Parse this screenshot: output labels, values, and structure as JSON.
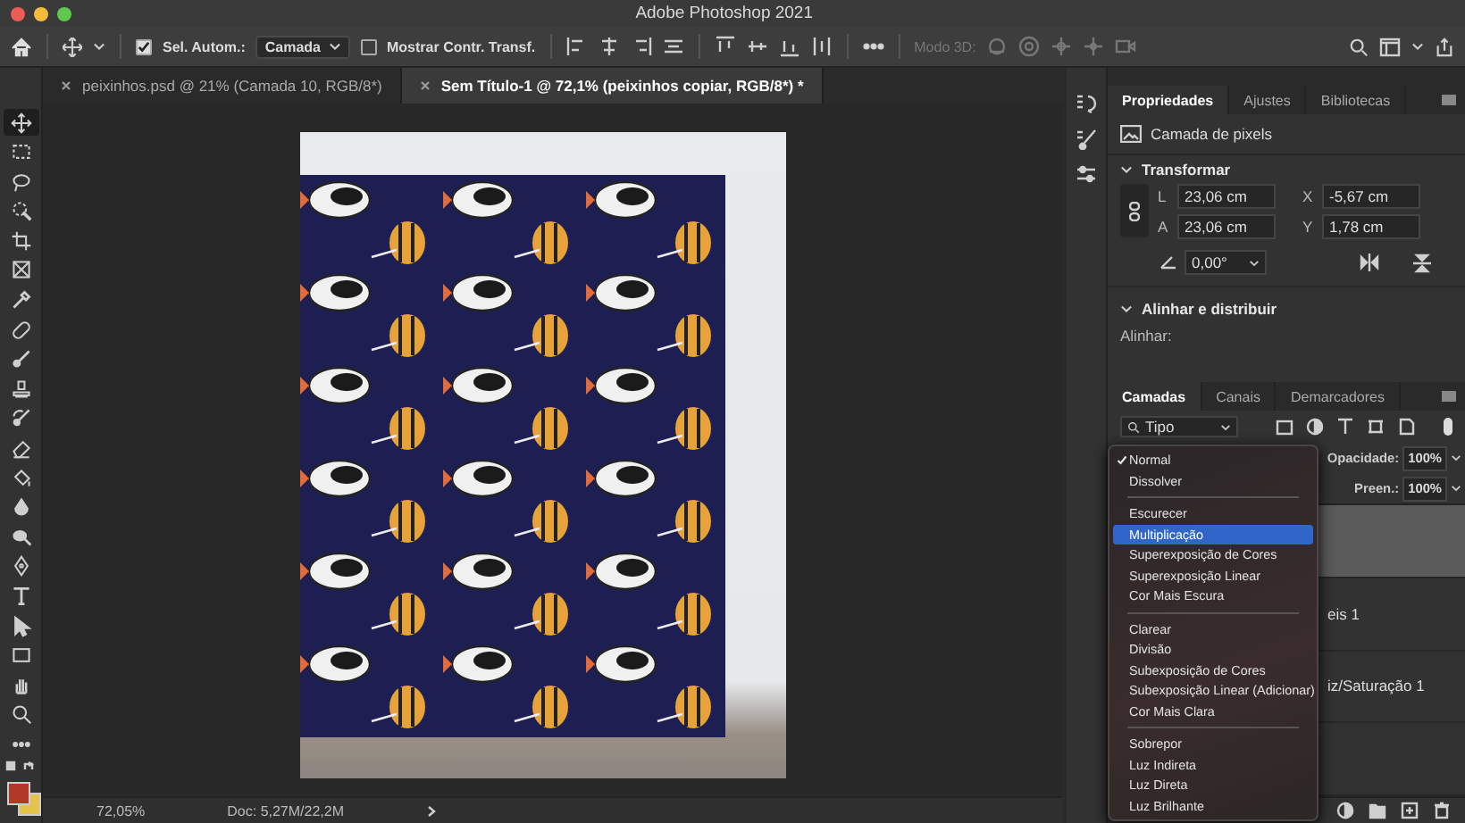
{
  "window": {
    "title": "Adobe Photoshop 2021"
  },
  "options_bar": {
    "auto_select": {
      "label": "Sel. Autom.:",
      "checked": true
    },
    "auto_select_target": "Camada",
    "transform_controls": {
      "label": "Mostrar Contr. Transf.",
      "checked": false
    },
    "mode_3d_label": "Modo 3D:"
  },
  "document_tabs": [
    {
      "label": "peixinhos.psd @ 21% (Camada 10, RGB/8*)",
      "selected": false
    },
    {
      "label": "Sem Título-1 @ 72,1% (peixinhos copiar, RGB/8*) *",
      "selected": true
    }
  ],
  "toolbar": {
    "tools": [
      {
        "selected": true
      },
      {
        "selected": false
      },
      {
        "selected": false
      },
      {
        "selected": false
      },
      {
        "selected": false
      },
      {
        "selected": false
      },
      {
        "selected": false
      },
      {
        "selected": false
      },
      {
        "selected": false
      },
      {
        "selected": false
      },
      {
        "selected": false
      },
      {
        "selected": false
      },
      {
        "selected": false
      },
      {
        "selected": false
      },
      {
        "selected": false
      },
      {
        "selected": false
      },
      {
        "selected": false
      },
      {
        "selected": false
      },
      {
        "selected": false
      },
      {
        "selected": false
      },
      {
        "selected": false
      },
      {
        "selected": false
      }
    ],
    "swatches": [
      {
        "color": "#b2392a"
      },
      {
        "color": "#e5c24b"
      }
    ]
  },
  "status_bar": {
    "zoom": "72,05%",
    "doc_size": "Doc: 5,27M/22,2M"
  },
  "properties_panel": {
    "tabs": [
      {
        "label": "Propriedades",
        "selected": true
      },
      {
        "label": "Ajustes",
        "selected": false
      },
      {
        "label": "Bibliotecas",
        "selected": false
      }
    ],
    "layer_kind": "Camada de pixels",
    "transform": {
      "title": "Transformar",
      "expanded": true,
      "width": {
        "label": "L",
        "value": "23,06 cm"
      },
      "height": {
        "label": "A",
        "value": "23,06 cm"
      },
      "x": {
        "label": "X",
        "value": "-5,67 cm"
      },
      "y": {
        "label": "Y",
        "value": "1,78 cm"
      },
      "angle": "0,00°"
    },
    "align": {
      "title": "Alinhar e distribuir",
      "expanded": true,
      "label": "Alinhar:"
    }
  },
  "layers_panel": {
    "tabs": [
      {
        "label": "Camadas",
        "selected": true
      },
      {
        "label": "Canais",
        "selected": false
      },
      {
        "label": "Demarcadores",
        "selected": false
      }
    ],
    "filter": "Tipo",
    "opacity": {
      "label": "Opacidade:",
      "value": "100%"
    },
    "fill": {
      "label": "Preen.:",
      "value": "100%"
    },
    "layers": [
      {
        "selected": true
      },
      {
        "name": "eis 1",
        "selected": false
      },
      {
        "name": "iz/Saturação 1",
        "selected": false
      },
      {
        "selected": false
      }
    ]
  },
  "blend_menu": {
    "groups": [
      [
        {
          "label": "Normal",
          "checked": true,
          "selected": false
        },
        {
          "label": "Dissolver",
          "checked": false,
          "selected": false
        }
      ],
      [
        {
          "label": "Escurecer",
          "checked": false,
          "selected": false
        },
        {
          "label": "Multiplicação",
          "checked": false,
          "selected": true
        },
        {
          "label": "Superexposição de Cores",
          "checked": false,
          "selected": false
        },
        {
          "label": "Superexposição Linear",
          "checked": false,
          "selected": false
        },
        {
          "label": "Cor Mais Escura",
          "checked": false,
          "selected": false
        }
      ],
      [
        {
          "label": "Clarear",
          "checked": false,
          "selected": false
        },
        {
          "label": "Divisão",
          "checked": false,
          "selected": false
        },
        {
          "label": "Subexposição de Cores",
          "checked": false,
          "selected": false
        },
        {
          "label": "Subexposição Linear (Adicionar)",
          "checked": false,
          "selected": false
        },
        {
          "label": "Cor Mais Clara",
          "checked": false,
          "selected": false
        }
      ],
      [
        {
          "label": "Sobrepor",
          "checked": false,
          "selected": false
        },
        {
          "label": "Luz Indireta",
          "checked": false,
          "selected": false
        },
        {
          "label": "Luz Direta",
          "checked": false,
          "selected": false
        },
        {
          "label": "Luz Brilhante",
          "checked": false,
          "selected": false
        }
      ]
    ]
  }
}
